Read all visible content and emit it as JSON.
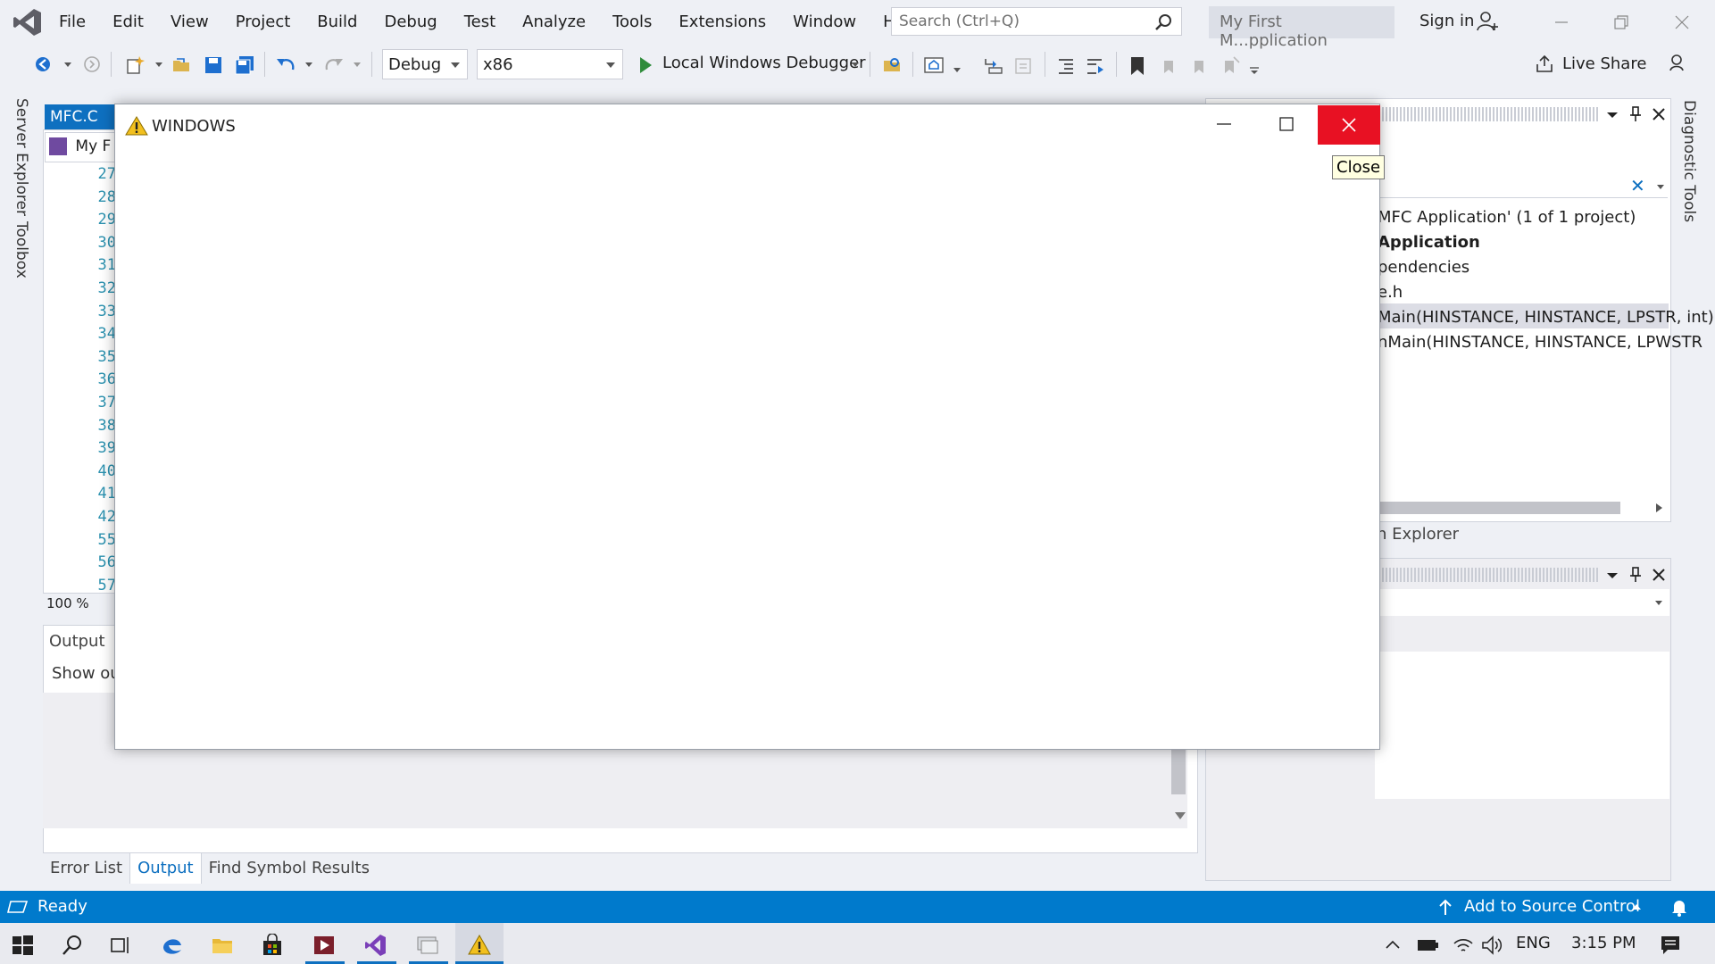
{
  "menu": [
    "File",
    "Edit",
    "View",
    "Project",
    "Build",
    "Debug",
    "Test",
    "Analyze",
    "Tools",
    "Extensions",
    "Window",
    "Help"
  ],
  "search": {
    "placeholder": "Search (Ctrl+Q)"
  },
  "solution_title": "My First M...pplication",
  "signin": "Sign in",
  "toolbar": {
    "config": "Debug",
    "platform": "x86",
    "run": "Local Windows Debugger",
    "live_share": "Live Share"
  },
  "left_tabs": [
    "Server Explorer",
    "Toolbox"
  ],
  "editor": {
    "tab": "MFC.C",
    "nav": "My F",
    "line_numbers": [
      "27",
      "28",
      "29",
      "30",
      "31",
      "32",
      "33",
      "34",
      "35",
      "36",
      "37",
      "38",
      "39",
      "40",
      "41",
      "42",
      "55",
      "56",
      "57"
    ],
    "zoom": "100 %"
  },
  "output": {
    "title": "Output",
    "show": "Show ou"
  },
  "bottom_tabs": [
    "Error List",
    "Output",
    "Find Symbol Results"
  ],
  "solution_tree": [
    "MFC Application' (1 of 1 project)",
    "Application",
    "pendencies",
    "e.h",
    "Main(HINSTANCE, HINSTANCE, LPSTR, int)",
    "nMain(HINSTANCE, HINSTANCE, LPWSTR"
  ],
  "solution_explorer_tab": "n Explorer",
  "diagnostic_tab": "Diagnostic Tools",
  "dialog": {
    "title": "WINDOWS",
    "tooltip": "Close"
  },
  "status": {
    "ready": "Ready",
    "source_control": "Add to Source Control"
  },
  "tray": {
    "lang": "ENG",
    "time": "3:15 PM"
  },
  "colors": {
    "accent": "#007acc",
    "close_red": "#e81123"
  }
}
